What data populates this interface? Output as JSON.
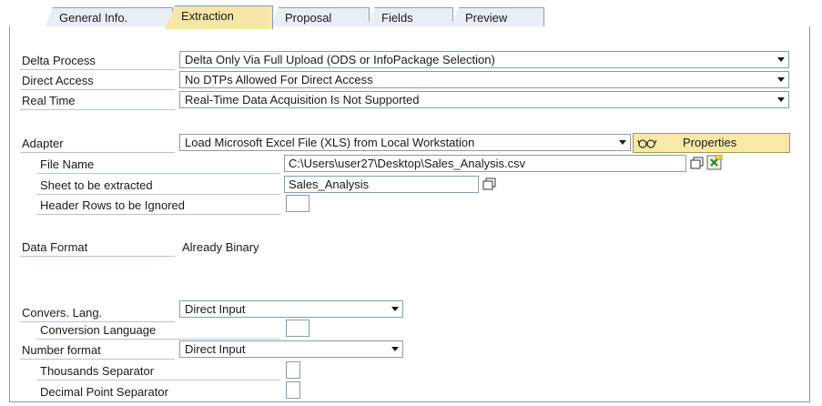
{
  "tabs": [
    {
      "label": "General Info.",
      "active": false
    },
    {
      "label": "Extraction",
      "active": true
    },
    {
      "label": "Proposal",
      "active": false
    },
    {
      "label": "Fields",
      "active": false
    },
    {
      "label": "Preview",
      "active": false
    }
  ],
  "delta_process": {
    "label": "Delta Process",
    "value": "Delta Only Via Full Upload (ODS or InfoPackage Selection)"
  },
  "direct_access": {
    "label": "Direct Access",
    "value": "No DTPs Allowed For Direct Access"
  },
  "real_time": {
    "label": "Real Time",
    "value": "Real-Time Data Acquisition Is Not Supported"
  },
  "adapter": {
    "label": "Adapter",
    "value": "Load Microsoft Excel File (XLS) from Local Workstation",
    "properties_label": "Properties"
  },
  "file_name": {
    "label": "File Name",
    "value": "C:\\Users\\user27\\Desktop\\Sales_Analysis.csv"
  },
  "sheet": {
    "label": "Sheet to be extracted",
    "value": "Sales_Analysis"
  },
  "header_rows": {
    "label": "Header Rows to be Ignored",
    "value": ""
  },
  "data_format": {
    "label": "Data Format",
    "value": "Already Binary"
  },
  "convers_lang": {
    "label": "Convers. Lang.",
    "value": "Direct Input"
  },
  "conversion_language": {
    "label": "Conversion Language",
    "value": ""
  },
  "number_format": {
    "label": "Number format",
    "value": "Direct Input"
  },
  "thousands_sep": {
    "label": "Thousands Separator",
    "value": ""
  },
  "decimal_sep": {
    "label": "Decimal Point Separator",
    "value": ""
  },
  "colors": {
    "active_tab": "#f6e6a8",
    "border": "#8a9bb0",
    "button": "#f8e9a8"
  }
}
